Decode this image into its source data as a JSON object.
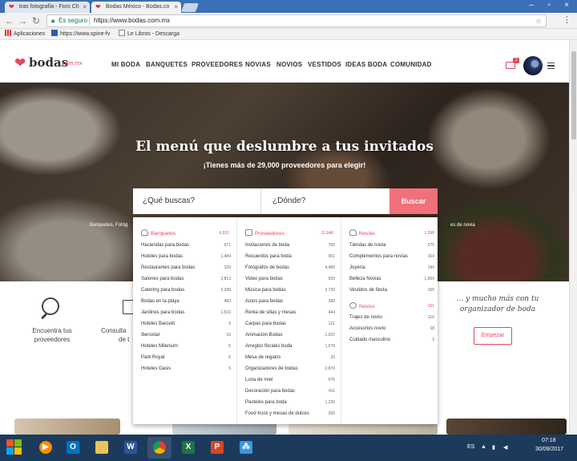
{
  "browser": {
    "tabs": [
      {
        "title": "tras fotografía - Foro Ch"
      },
      {
        "title": "Bodas México - Bodas.co"
      }
    ],
    "address": {
      "secure_label": "Es seguro",
      "url": "https://www.bodas.com.mx"
    },
    "bookmarks": [
      {
        "label": "Aplicaciones"
      },
      {
        "label": "https://www.spine-fv"
      },
      {
        "label": "Le Libros - Descarga"
      }
    ]
  },
  "site": {
    "logo_word": "bodas",
    "logo_tld": ".com.mx",
    "nav": [
      "MI BODA",
      "BANQUETES",
      "PROVEEDORES",
      "NOVIAS",
      "NOVIOS",
      "VESTIDOS",
      "IDEAS BODA",
      "COMUNIDAD"
    ],
    "notification_count": "1"
  },
  "hero": {
    "title": "El menú que deslumbre a tus invitados",
    "subtitle": "¡Tienes más de 29,000 proveedores para elegir!",
    "chip_left": "Banquetes, Fotóg",
    "chip_right": "es de novia",
    "search_what_placeholder": "¿Qué buscas?",
    "search_where_placeholder": "¿Dónde?",
    "search_button": "Buscar"
  },
  "dropdown": {
    "banquetes": {
      "title": "Banquetes",
      "count": "6,931",
      "items": [
        {
          "label": "Haciendas para bodas",
          "count": "671"
        },
        {
          "label": "Hoteles para bodas",
          "count": "1,484"
        },
        {
          "label": "Restaurantes para bodas",
          "count": "329"
        },
        {
          "label": "Salones para bodas",
          "count": "2,813"
        },
        {
          "label": "Catering para bodas",
          "count": "2,298"
        },
        {
          "label": "Bodas en la playa",
          "count": "483"
        },
        {
          "label": "Jardines para bodas",
          "count": "1,516"
        },
        {
          "label": "Hoteles Barceló",
          "count": "9"
        },
        {
          "label": "Iberostar",
          "count": "10"
        },
        {
          "label": "Hoteles Milenium",
          "count": "5"
        },
        {
          "label": "Park Royal",
          "count": "6"
        },
        {
          "label": "Hoteles Oasis",
          "count": "5"
        }
      ]
    },
    "proveedores": {
      "title": "Proveedores",
      "count": "11,946",
      "items": [
        {
          "label": "Invitaciones de boda",
          "count": "706"
        },
        {
          "label": "Recuerdos para boda",
          "count": "991"
        },
        {
          "label": "Fotógrafos de bodas",
          "count": "4,489"
        },
        {
          "label": "Video para bodas",
          "count": "930"
        },
        {
          "label": "Música para bodas",
          "count": "2,730"
        },
        {
          "label": "Autos para bodas",
          "count": "288"
        },
        {
          "label": "Renta de sillas y mesas",
          "count": "444"
        },
        {
          "label": "Carpas para bodas",
          "count": "121"
        },
        {
          "label": "Animación Bodas",
          "count": "1,022"
        },
        {
          "label": "Arreglos florales boda",
          "count": "1,078"
        },
        {
          "label": "Mesa de regalos",
          "count": "20"
        },
        {
          "label": "Organizadores de bodas",
          "count": "2,876"
        },
        {
          "label": "Luna de miel",
          "count": "676"
        },
        {
          "label": "Decoración para bodas",
          "count": "411"
        },
        {
          "label": "Pasteles para boda",
          "count": "1,236"
        },
        {
          "label": "Food truck y mesas de dulces",
          "count": "260"
        }
      ]
    },
    "novias": {
      "title": "Novias",
      "count": "1,598",
      "items": [
        {
          "label": "Tiendas de novia",
          "count": "275"
        },
        {
          "label": "Complementos para novias",
          "count": "164"
        },
        {
          "label": "Joyería",
          "count": "190"
        },
        {
          "label": "Belleza Novias",
          "count": "1,069"
        },
        {
          "label": "Vestidos de fiesta",
          "count": "155"
        }
      ]
    },
    "novios": {
      "title": "Novios",
      "count": "151",
      "items": [
        {
          "label": "Trajes de novio",
          "count": "110"
        },
        {
          "label": "Accesorios novio",
          "count": "18"
        },
        {
          "label": "Cuidado masculino",
          "count": "3"
        }
      ]
    }
  },
  "features": {
    "find_line1": "Encuentra tus",
    "find_line2": "proveedores",
    "consult_line1": "Consulta",
    "consult_line2": "de t",
    "script_text": "... y mucho más con tu organizador de boda",
    "start_button": "Empezar"
  },
  "taskbar": {
    "lang": "ES",
    "time": "07:18",
    "date": "30/09/2017"
  }
}
